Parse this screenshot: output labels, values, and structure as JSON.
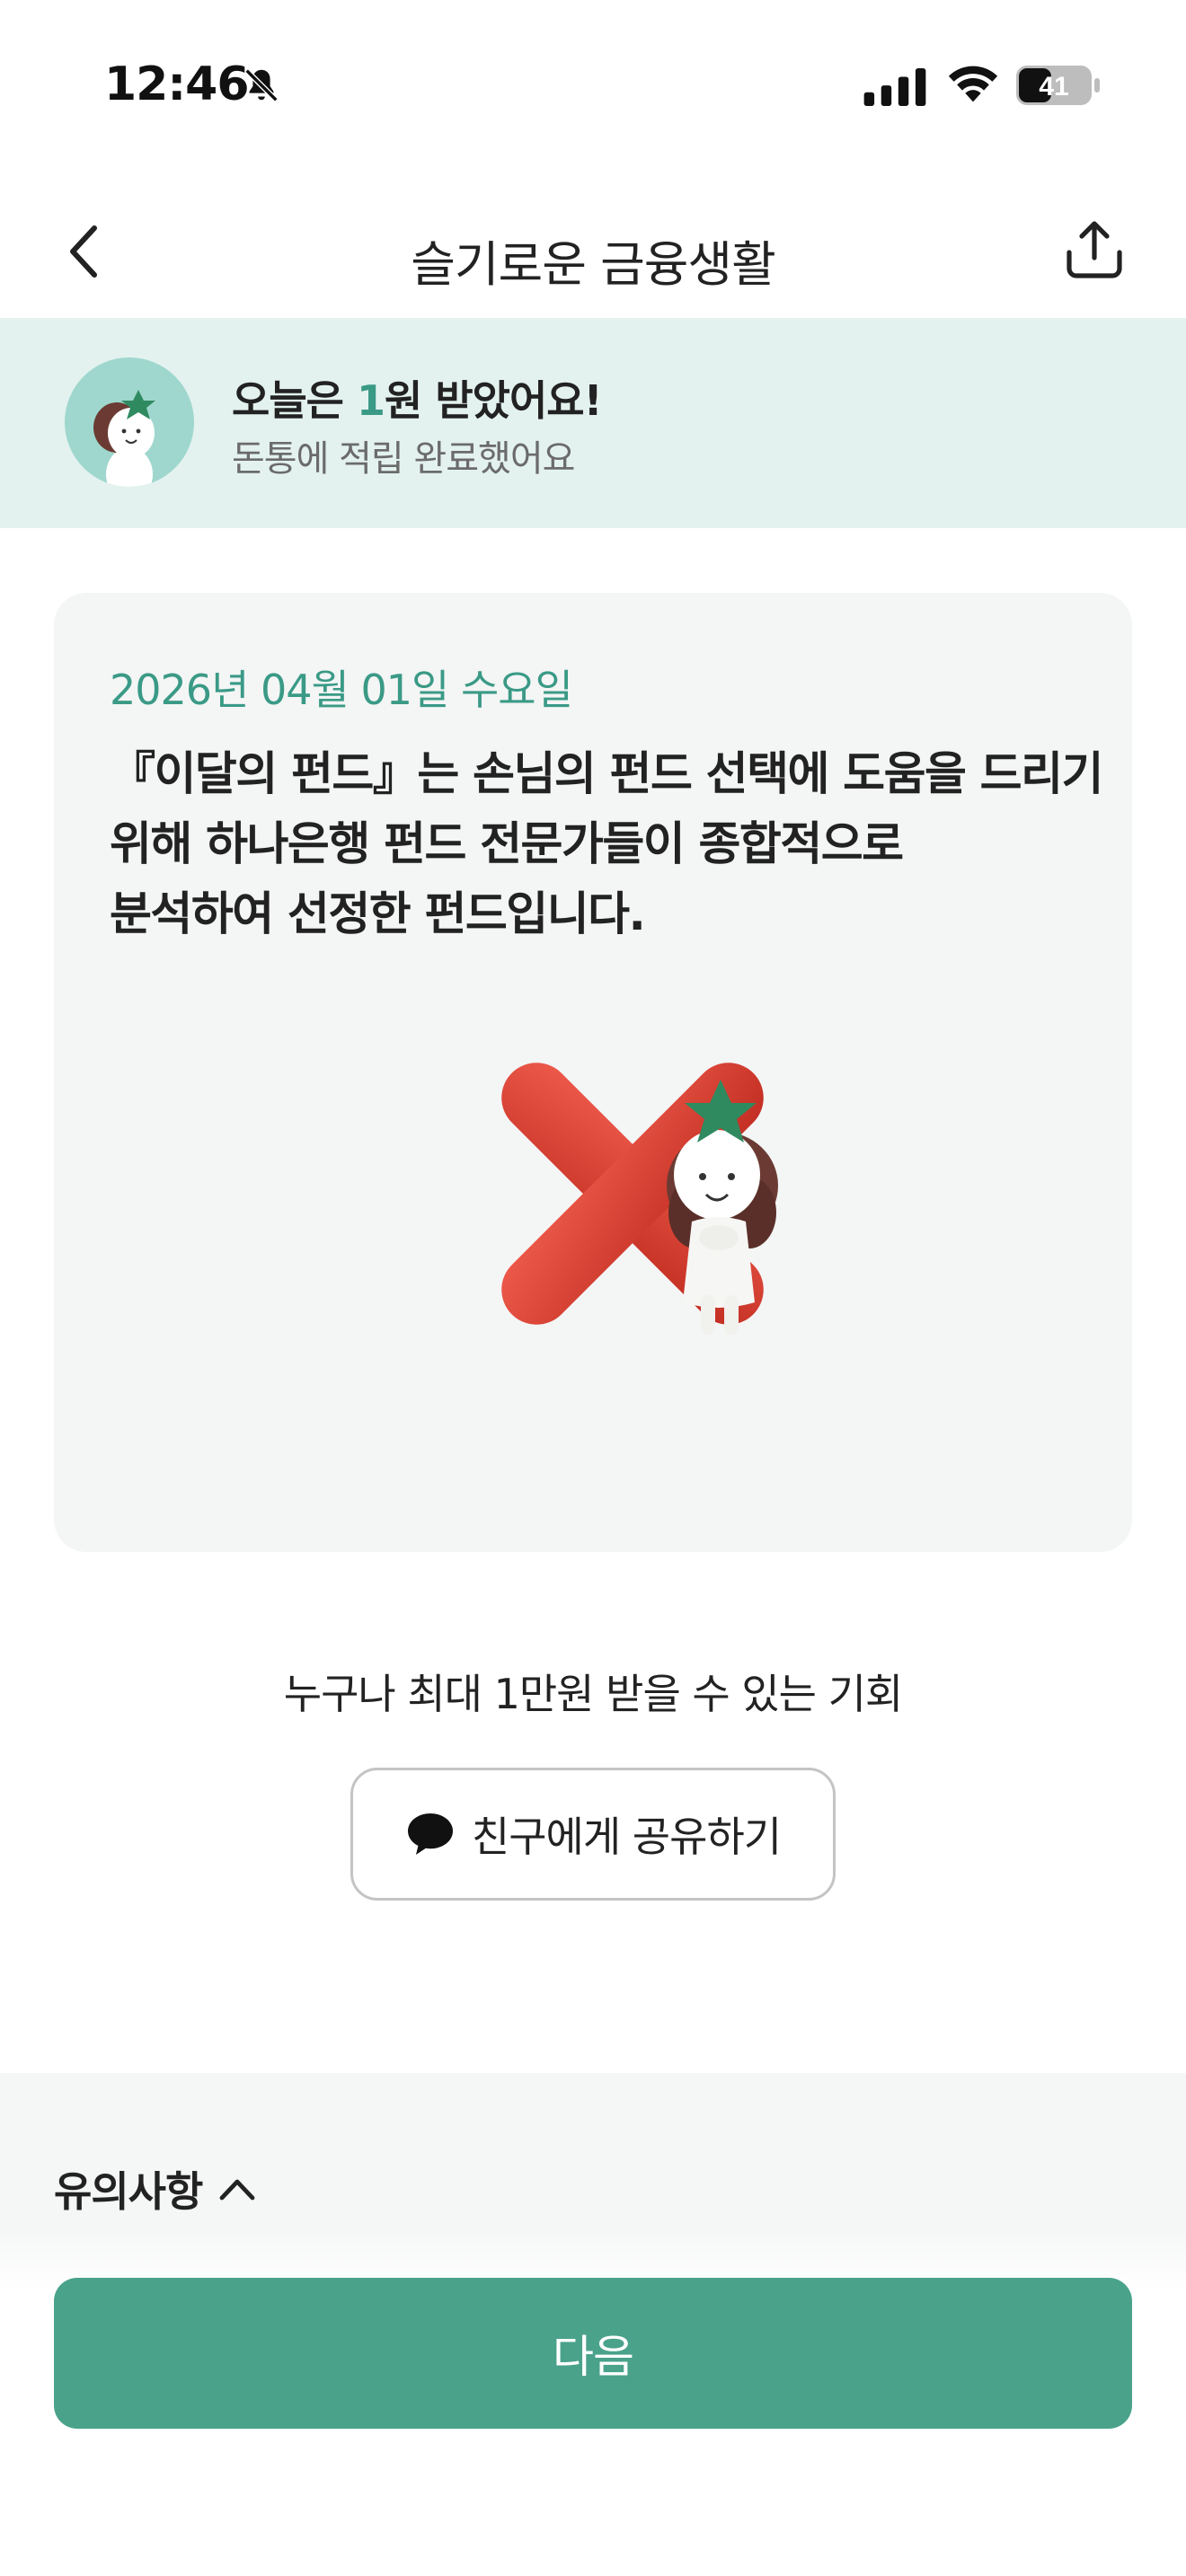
{
  "status_bar": {
    "time": "12:46",
    "battery": "41",
    "icons": [
      "bell-off-icon",
      "signal-icon",
      "wifi-icon",
      "battery-icon"
    ]
  },
  "header": {
    "title": "슬기로운 금융생활",
    "back_icon": "chevron-left-icon",
    "share_icon": "share-upload-icon"
  },
  "banner": {
    "title_prefix": "오늘은 ",
    "title_amount": "1",
    "title_suffix": "원 받았어요!",
    "subtitle": "돈통에 적립 완료했어요",
    "accent_color": "#3a9a86",
    "background": "#e3f2ef"
  },
  "quiz_card": {
    "date": "2026년 04월 01일 수요일",
    "description_lines": [
      "『이달의 펀드』는 손님의 펀드 선택에 도움을 드리기",
      "위해 하나은행 펀드 전문가들이 종합적으로",
      "분석하여 선정한 펀드입니다."
    ],
    "result_icon": "red-x-incorrect-icon",
    "result_color": "#d8392c"
  },
  "opportunity": {
    "text": "누구나 최대 1만원 받을 수 있는 기회",
    "share_label": "친구에게 공유하기",
    "share_icon": "chat-bubble-icon"
  },
  "notice": {
    "label": "유의사항",
    "icon": "chevron-up-icon"
  },
  "footer": {
    "next_label": "다음",
    "button_color": "#4aa28b"
  }
}
